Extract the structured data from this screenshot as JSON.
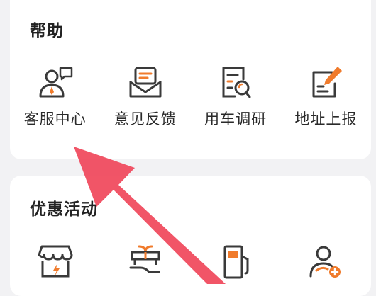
{
  "help": {
    "title": "帮助",
    "items": [
      {
        "label": "客服中心",
        "icon": "customer-service-icon"
      },
      {
        "label": "意见反馈",
        "icon": "feedback-icon"
      },
      {
        "label": "用车调研",
        "icon": "survey-icon"
      },
      {
        "label": "地址上报",
        "icon": "address-report-icon"
      }
    ]
  },
  "promotions": {
    "title": "优惠活动",
    "items": [
      {
        "icon": "store-icon"
      },
      {
        "icon": "gift-icon"
      },
      {
        "icon": "fuel-pump-icon"
      },
      {
        "icon": "invite-user-icon"
      }
    ]
  },
  "colors": {
    "accent": "#f07b2c",
    "icon_stroke": "#3a3a3a",
    "arrow": "#f0475a"
  }
}
